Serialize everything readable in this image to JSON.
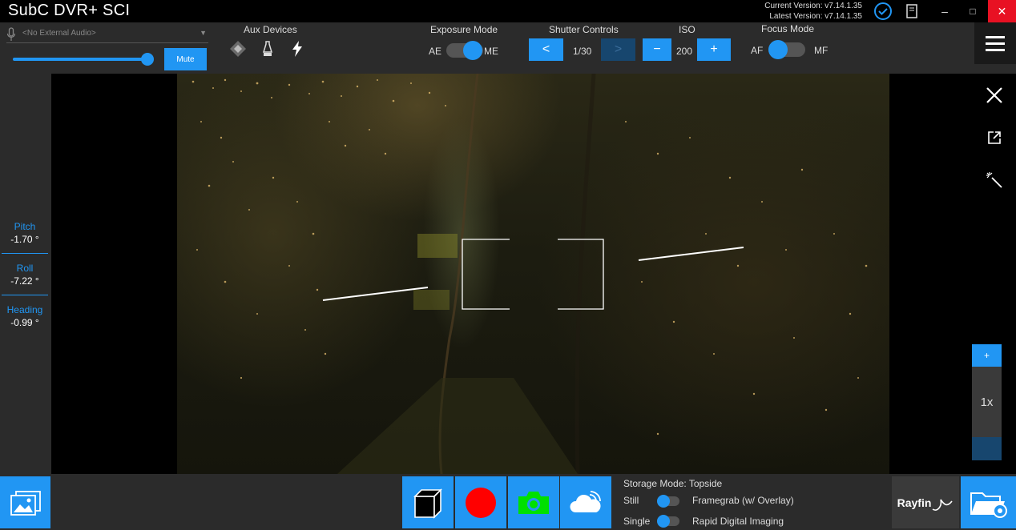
{
  "app": {
    "title": "SubC DVR+ SCI"
  },
  "versions": {
    "current": "Current Version: v7.14.1.35",
    "latest": "Latest Version: v7.14.1.35"
  },
  "window_controls": {
    "minimize": "–",
    "maximize": "□",
    "close": "✕"
  },
  "audio": {
    "placeholder": "<No External Audio>",
    "volume_fraction": 1.0,
    "mute_label": "Mute"
  },
  "aux_devices": {
    "label": "Aux Devices",
    "icons": [
      "diamond-icon",
      "lamp-icon",
      "lightning-icon"
    ]
  },
  "exposure": {
    "label": "Exposure Mode",
    "left": "AE",
    "right": "ME",
    "selected": "ME"
  },
  "shutter": {
    "label": "Shutter Controls",
    "prev": "<",
    "value": "1/30",
    "next": ">"
  },
  "iso": {
    "label": "ISO",
    "minus": "−",
    "value": "200",
    "plus": "+"
  },
  "focus": {
    "label": "Focus Mode",
    "left": "AF",
    "right": "MF",
    "selected": "AF"
  },
  "sensors": [
    {
      "label": "Pitch",
      "value": "-1.70 °"
    },
    {
      "label": "Roll",
      "value": "-7.22 °"
    },
    {
      "label": "Heading",
      "value": "-0.99 °"
    }
  ],
  "zoom": {
    "plus": "+",
    "level": "1x"
  },
  "storage": {
    "mode_text": "Storage Mode: Topside",
    "still_label": "Still",
    "still_desc": "Framegrab (w/ Overlay)",
    "single_label": "Single",
    "single_desc": "Rapid Digital Imaging"
  },
  "logo": {
    "text": "Rayfin"
  },
  "colors": {
    "accent": "#2196f3",
    "record": "#ff0000",
    "camera": "#00e000",
    "close": "#e81123"
  }
}
